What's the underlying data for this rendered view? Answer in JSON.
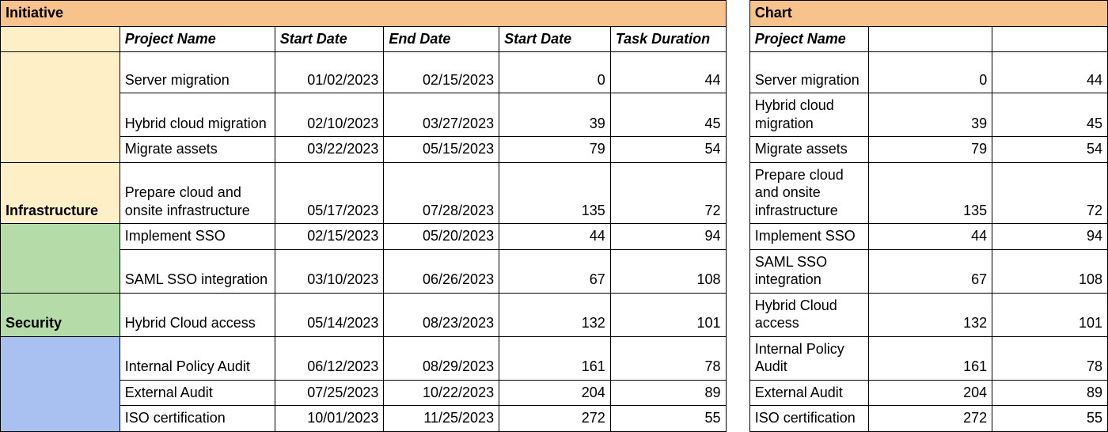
{
  "leftTitle": "Initiative",
  "rightTitle": "Chart",
  "headers": {
    "project": "Project Name",
    "start": "Start Date",
    "end": "End Date",
    "start2": "Start Date",
    "dur": "Task Duration"
  },
  "initiatives": {
    "infra": "Infrastructure",
    "sec": "Security",
    "comp": ""
  },
  "rows": [
    {
      "init": "infra",
      "name": "Server migration",
      "start": "01/02/2023",
      "end": "02/15/2023",
      "start2": 0,
      "dur": 44
    },
    {
      "init": "infra",
      "name": "Hybrid cloud migration",
      "start": "02/10/2023",
      "end": "03/27/2023",
      "start2": 39,
      "dur": 45
    },
    {
      "init": "infra",
      "name": "Migrate assets",
      "start": "03/22/2023",
      "end": "05/15/2023",
      "start2": 79,
      "dur": 54
    },
    {
      "init": "infra",
      "name": "Prepare cloud and onsite infrastructure",
      "start": "05/17/2023",
      "end": "07/28/2023",
      "start2": 135,
      "dur": 72
    },
    {
      "init": "sec",
      "name": "Implement SSO",
      "start": "02/15/2023",
      "end": "05/20/2023",
      "start2": 44,
      "dur": 94
    },
    {
      "init": "sec",
      "name": "SAML SSO integration",
      "start": "03/10/2023",
      "end": "06/26/2023",
      "start2": 67,
      "dur": 108
    },
    {
      "init": "sec",
      "name": "Hybrid Cloud access",
      "start": "05/14/2023",
      "end": "08/23/2023",
      "start2": 132,
      "dur": 101
    },
    {
      "init": "comp",
      "name": "Internal Policy Audit",
      "start": "06/12/2023",
      "end": "08/29/2023",
      "start2": 161,
      "dur": 78
    },
    {
      "init": "comp",
      "name": "External Audit",
      "start": "07/25/2023",
      "end": "10/22/2023",
      "start2": 204,
      "dur": 89
    },
    {
      "init": "comp",
      "name": "ISO certification",
      "start": "10/01/2023",
      "end": "11/25/2023",
      "start2": 272,
      "dur": 55
    }
  ],
  "chart_data": {
    "type": "table",
    "title": "Project schedule",
    "columns": [
      "Initiative",
      "Project Name",
      "Start Date",
      "End Date",
      "Start Date",
      "Task Duration"
    ],
    "series": [
      {
        "name": "Infrastructure",
        "rows": [
          [
            "Server migration",
            "01/02/2023",
            "02/15/2023",
            0,
            44
          ],
          [
            "Hybrid cloud migration",
            "02/10/2023",
            "03/27/2023",
            39,
            45
          ],
          [
            "Migrate assets",
            "03/22/2023",
            "05/15/2023",
            79,
            54
          ],
          [
            "Prepare cloud and onsite infrastructure",
            "05/17/2023",
            "07/28/2023",
            135,
            72
          ]
        ]
      },
      {
        "name": "Security",
        "rows": [
          [
            "Implement SSO",
            "02/15/2023",
            "05/20/2023",
            44,
            94
          ],
          [
            "SAML SSO integration",
            "03/10/2023",
            "06/26/2023",
            67,
            108
          ],
          [
            "Hybrid Cloud access",
            "05/14/2023",
            "08/23/2023",
            132,
            101
          ]
        ]
      },
      {
        "name": "",
        "rows": [
          [
            "Internal Policy Audit",
            "06/12/2023",
            "08/29/2023",
            161,
            78
          ],
          [
            "External Audit",
            "07/25/2023",
            "10/22/2023",
            204,
            89
          ],
          [
            "ISO certification",
            "10/01/2023",
            "11/25/2023",
            272,
            55
          ]
        ]
      }
    ]
  }
}
